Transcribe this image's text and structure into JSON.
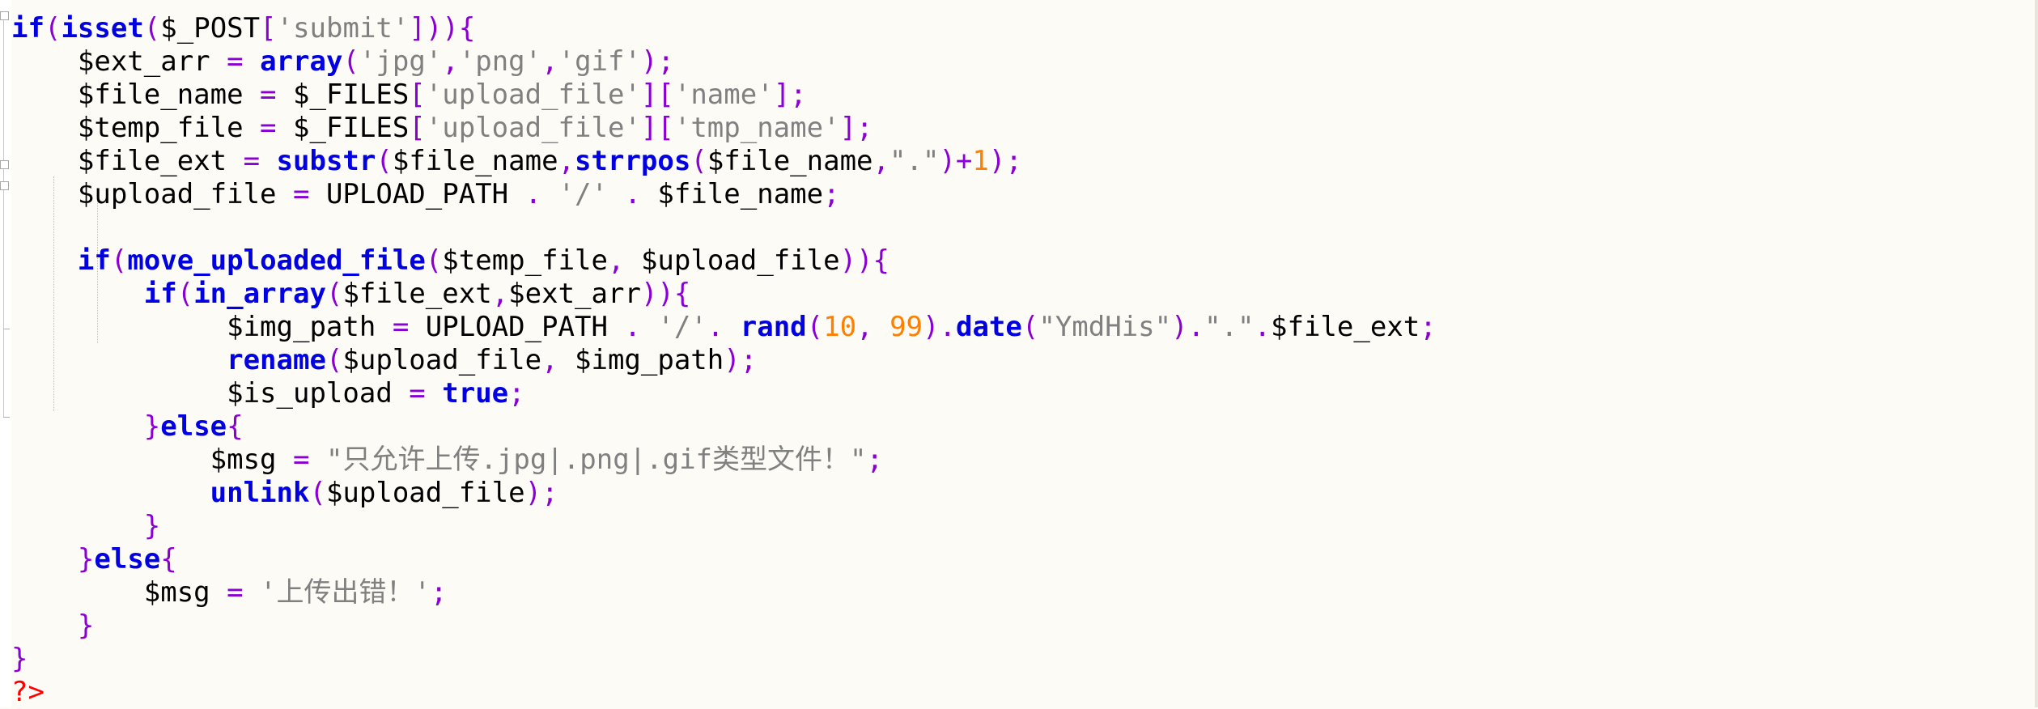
{
  "editor": {
    "language": "php",
    "lines": [
      "if(isset($_POST['submit'])){",
      "    $ext_arr = array('jpg','png','gif');",
      "    $file_name = $_FILES['upload_file']['name'];",
      "    $temp_file = $_FILES['upload_file']['tmp_name'];",
      "    $file_ext = substr($file_name,strrpos($file_name,\".\")+1);",
      "    $upload_file = UPLOAD_PATH . '/' . $file_name;",
      "",
      "    if(move_uploaded_file($temp_file, $upload_file)){",
      "        if(in_array($file_ext,$ext_arr)){",
      "             $img_path = UPLOAD_PATH . '/'. rand(10, 99).date(\"YmdHis\").\".\".$file_ext;",
      "             rename($upload_file, $img_path);",
      "             $is_upload = true;",
      "        }else{",
      "            $msg = \"只允许上传.jpg|.png|.gif类型文件！\";",
      "            unlink($upload_file);",
      "        }",
      "    }else{",
      "        $msg = '上传出错！';",
      "    }",
      "}",
      "?>"
    ],
    "colors": {
      "background": "#fdfbf6",
      "keyword": "#0000e0",
      "string": "#808080",
      "operator": "#8a00d4",
      "number": "#ff8000",
      "php_tag": "#ff0000"
    }
  }
}
